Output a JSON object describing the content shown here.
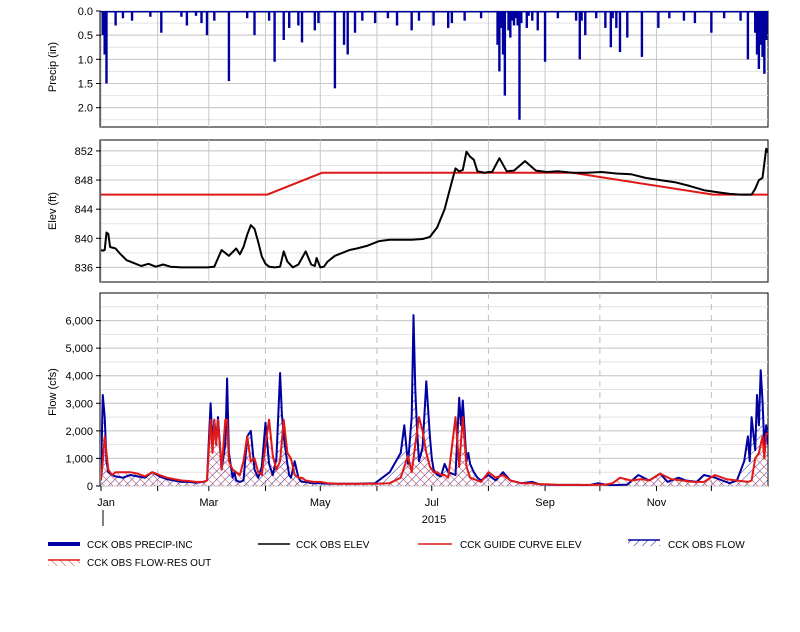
{
  "colors": {
    "precip": "#0000A0",
    "obs_elev": "#000000",
    "guide_curve": "#E01818",
    "obs_flow": "#0000A0",
    "res_out": "#E01818",
    "grid": "#C8C8C8",
    "month_marker": "#BEBEBE"
  },
  "chart_data": [
    {
      "type": "bar",
      "panel": "precipitation",
      "ylabel": "Precip (in)",
      "y_inverted": true,
      "ylim": [
        0,
        2.4
      ],
      "yticks": [
        0.0,
        0.5,
        1.0,
        1.5,
        2.0
      ],
      "ytick_labels": [
        "0.0",
        "0.5",
        "1.0",
        "1.5",
        "2.0"
      ],
      "grid": true,
      "series": [
        {
          "name": "CCK OBS PRECIP-INC",
          "x": [
            1,
            2,
            3,
            8,
            12,
            17,
            27,
            33,
            44,
            47,
            52,
            55,
            58,
            62,
            70,
            80,
            84,
            92,
            95,
            100,
            103,
            108,
            110,
            117,
            119,
            128,
            133,
            135,
            139,
            143,
            150,
            157,
            162,
            170,
            174,
            182,
            190,
            192,
            199,
            208,
            219,
            226,
            230,
            233,
            236,
            239,
            243,
            250,
            260,
            271,
            276,
            279,
            284,
            288,
            296,
            305,
            311,
            319,
            325,
            334,
            341,
            350,
            354,
            358,
            362,
            364
          ],
          "values": [
            0.5,
            0.9,
            1.5,
            0.3,
            0.15,
            0.2,
            0.12,
            0.45,
            0.12,
            0.3,
            0.1,
            0.25,
            0.5,
            0.2,
            1.45,
            0.15,
            0.5,
            0.2,
            1.05,
            0.6,
            0.35,
            0.3,
            0.65,
            0.4,
            0.25,
            1.6,
            0.7,
            0.9,
            0.45,
            0.2,
            0.25,
            0.15,
            0.3,
            0.4,
            0.2,
            0.3,
            0.35,
            0.25,
            0.2,
            0.15,
            0.35,
            0.3,
            0.25,
            0.35,
            0.2,
            0.4,
            1.05,
            0.15,
            0.2,
            0.15,
            0.35,
            0.75,
            0.85,
            0.55,
            0.95,
            0.35,
            0.15,
            0.2,
            0.25,
            0.45,
            0.15,
            0.2,
            1.0,
            0.1,
            0.2,
            0.5
          ],
          "x_extra_spikes": [
            [
              217,
              0.7
            ],
            [
              218,
              1.25
            ],
            [
              220,
              0.9
            ],
            [
              221,
              1.75
            ],
            [
              223,
              0.4
            ],
            [
              224,
              0.55
            ],
            [
              225,
              0.2
            ],
            [
              227,
              0.15
            ],
            [
              228,
              0.3
            ],
            [
              229,
              2.25
            ],
            [
              234,
              0.1
            ],
            [
              262,
              1.0
            ],
            [
              263,
              0.2
            ],
            [
              265,
              0.5
            ],
            [
              280,
              0.15
            ],
            [
              282,
              0.35
            ],
            [
              358,
              0.45
            ],
            [
              359,
              0.9
            ],
            [
              360,
              1.2
            ],
            [
              361,
              0.7
            ],
            [
              362,
              0.95
            ],
            [
              363,
              1.3
            ],
            [
              364,
              0.6
            ],
            [
              365,
              0.3
            ]
          ]
        }
      ]
    },
    {
      "type": "line",
      "panel": "elevation",
      "ylabel": "Elev (ft)",
      "ylim": [
        834,
        853.5
      ],
      "yticks": [
        836,
        840,
        844,
        848,
        852
      ],
      "ytick_labels": [
        "836",
        "840",
        "844",
        "848",
        "852"
      ],
      "grid": true,
      "series": [
        {
          "name": "CCK OBS ELEV",
          "x": [
            0,
            1,
            2,
            3,
            4,
            5,
            8,
            10,
            14,
            18,
            22,
            26,
            30,
            34,
            38,
            44,
            50,
            58,
            62,
            66,
            70,
            74,
            76,
            78,
            80,
            82,
            84,
            86,
            88,
            90,
            92,
            95,
            98,
            100,
            102,
            105,
            108,
            112,
            115,
            117,
            118,
            120,
            122,
            124,
            126,
            128,
            132,
            136,
            140,
            146,
            152,
            158,
            164,
            170,
            176,
            180,
            184,
            188,
            192,
            194,
            196,
            198,
            200,
            202,
            204,
            206,
            208,
            210,
            212,
            214,
            218,
            222,
            226,
            232,
            238,
            244,
            250,
            258,
            266,
            274,
            282,
            290,
            298,
            306,
            314,
            322,
            330,
            338,
            344,
            350,
            354,
            356,
            358,
            360,
            362,
            364,
            365
          ],
          "values": [
            838.4,
            838.3,
            838.4,
            840.8,
            840.6,
            838.8,
            838.6,
            838.0,
            837.0,
            836.6,
            836.2,
            836.5,
            836.1,
            836.4,
            836.1,
            836.0,
            836.0,
            836.0,
            836.1,
            838.4,
            837.6,
            838.6,
            837.8,
            838.8,
            840.5,
            841.8,
            841.3,
            839.5,
            837.5,
            836.5,
            836.1,
            836.0,
            836.1,
            838.2,
            836.8,
            836.0,
            836.4,
            838.2,
            836.4,
            836.2,
            837.3,
            836.0,
            836.1,
            836.8,
            837.2,
            837.6,
            838.0,
            838.4,
            838.6,
            839.0,
            839.6,
            839.8,
            839.8,
            839.8,
            839.9,
            840.2,
            841.5,
            844.0,
            847.8,
            849.6,
            849.2,
            849.4,
            851.9,
            851.2,
            850.8,
            849.2,
            849.1,
            849.0,
            849.1,
            849.1,
            851.0,
            849.2,
            849.3,
            850.6,
            849.3,
            849.1,
            849.2,
            849.0,
            849.0,
            849.1,
            848.9,
            848.8,
            848.3,
            848.0,
            847.7,
            847.2,
            846.6,
            846.3,
            846.1,
            846.0,
            846.0,
            846.0,
            846.8,
            848.0,
            848.3,
            852.3,
            851.8
          ]
        },
        {
          "name": "CCK GUIDE CURVE ELEV",
          "x": [
            0,
            91,
            121,
            258,
            335,
            365
          ],
          "values": [
            846.0,
            846.0,
            849.0,
            849.0,
            846.0,
            846.0
          ]
        }
      ]
    },
    {
      "type": "area",
      "panel": "flow",
      "ylabel": "Flow (cfs)",
      "ylim": [
        0,
        7000
      ],
      "yticks": [
        0,
        1000,
        2000,
        3000,
        4000,
        5000,
        6000
      ],
      "ytick_labels": [
        "0",
        "1,000",
        "2,000",
        "3,000",
        "4,000",
        "5,000",
        "6,000"
      ],
      "grid": true,
      "xlabel": "2015",
      "xtick_labels": [
        "Jan",
        "Mar",
        "May",
        "Jul",
        "Sep",
        "Nov"
      ],
      "xtick_days": [
        0,
        59,
        120,
        181,
        243,
        304
      ],
      "series": [
        {
          "name": "CCK OBS FLOW",
          "x": [
            0,
            1,
            2,
            3,
            4,
            6,
            8,
            12,
            16,
            20,
            24,
            28,
            32,
            36,
            40,
            44,
            48,
            52,
            56,
            58,
            60,
            61,
            62,
            63,
            64,
            66,
            68,
            69,
            70,
            72,
            73,
            74,
            76,
            78,
            80,
            82,
            84,
            86,
            88,
            90,
            92,
            94,
            96,
            98,
            99,
            100,
            102,
            103,
            104,
            106,
            108,
            109,
            110,
            112,
            114,
            116,
            120,
            124,
            130,
            140,
            150,
            158,
            164,
            166,
            168,
            170,
            171,
            172,
            173,
            174,
            176,
            178,
            180,
            181,
            182,
            184,
            186,
            188,
            190,
            194,
            196,
            197,
            198,
            200,
            201,
            202,
            204,
            206,
            208,
            212,
            216,
            220,
            224,
            230,
            236,
            240,
            244,
            250,
            256,
            262,
            266,
            268,
            272,
            276,
            280,
            284,
            288,
            294,
            300,
            306,
            310,
            316,
            320,
            326,
            330,
            336,
            340,
            344,
            348,
            352,
            354,
            355,
            356,
            358,
            359,
            360,
            361,
            362,
            363,
            364,
            365
          ],
          "values": [
            400,
            3300,
            2500,
            900,
            500,
            400,
            350,
            300,
            400,
            350,
            300,
            500,
            350,
            250,
            200,
            150,
            150,
            120,
            150,
            200,
            3000,
            1500,
            2400,
            1600,
            2500,
            600,
            1500,
            3900,
            1200,
            300,
            500,
            200,
            150,
            200,
            1800,
            2000,
            600,
            300,
            700,
            2300,
            800,
            400,
            1000,
            4100,
            2600,
            1800,
            800,
            400,
            300,
            900,
            300,
            200,
            150,
            150,
            120,
            100,
            100,
            80,
            80,
            80,
            100,
            500,
            1200,
            2200,
            800,
            2500,
            6200,
            3500,
            2000,
            900,
            1400,
            3800,
            1800,
            1000,
            600,
            400,
            350,
            800,
            500,
            400,
            3200,
            2200,
            3100,
            900,
            1200,
            800,
            500,
            300,
            200,
            400,
            200,
            500,
            200,
            100,
            150,
            60,
            50,
            40,
            40,
            40,
            30,
            40,
            100,
            50,
            30,
            40,
            50,
            400,
            200,
            450,
            150,
            300,
            200,
            150,
            400,
            300,
            200,
            100,
            200,
            900,
            1800,
            900,
            2500,
            1300,
            3300,
            2200,
            4200,
            3100,
            1500,
            2200,
            1500
          ]
        },
        {
          "name": "CCK OBS FLOW-RES OUT",
          "x": [
            0,
            1,
            2,
            3,
            4,
            6,
            8,
            12,
            16,
            20,
            24,
            28,
            32,
            36,
            40,
            44,
            48,
            52,
            56,
            58,
            60,
            61,
            62,
            63,
            64,
            66,
            68,
            69,
            70,
            72,
            74,
            76,
            78,
            80,
            82,
            84,
            86,
            88,
            90,
            92,
            94,
            96,
            98,
            100,
            102,
            104,
            106,
            108,
            110,
            112,
            116,
            120,
            124,
            130,
            140,
            150,
            158,
            164,
            166,
            168,
            170,
            172,
            174,
            176,
            178,
            180,
            182,
            184,
            186,
            188,
            190,
            194,
            196,
            198,
            200,
            202,
            204,
            206,
            208,
            212,
            216,
            220,
            224,
            230,
            236,
            240,
            244,
            250,
            256,
            262,
            266,
            270,
            276,
            280,
            284,
            290,
            296,
            300,
            306,
            312,
            318,
            324,
            330,
            336,
            342,
            348,
            354,
            356,
            358,
            360,
            362,
            363,
            364,
            365
          ],
          "values": [
            200,
            900,
            1800,
            1200,
            600,
            400,
            500,
            500,
            500,
            450,
            350,
            500,
            400,
            300,
            250,
            200,
            180,
            150,
            150,
            200,
            2400,
            1200,
            2400,
            1500,
            2400,
            600,
            2400,
            2400,
            900,
            600,
            500,
            400,
            900,
            1800,
            900,
            1000,
            500,
            400,
            1500,
            2400,
            1100,
            600,
            900,
            2400,
            1200,
            1000,
            400,
            300,
            300,
            200,
            150,
            150,
            100,
            80,
            80,
            80,
            100,
            300,
            700,
            1100,
            500,
            1500,
            2500,
            2000,
            1200,
            700,
            500,
            500,
            400,
            400,
            300,
            2500,
            700,
            2500,
            700,
            300,
            250,
            200,
            150,
            500,
            300,
            400,
            200,
            100,
            100,
            60,
            60,
            40,
            40,
            40,
            40,
            40,
            50,
            100,
            300,
            200,
            250,
            200,
            450,
            250,
            200,
            150,
            150,
            400,
            250,
            200,
            150,
            200,
            1000,
            1200,
            1800,
            1000,
            1900,
            1900
          ]
        }
      ]
    }
  ],
  "legend": {
    "placement": "bottom",
    "items": [
      {
        "label": "CCK OBS PRECIP-INC",
        "style": "thick-line",
        "color": "#0000A0"
      },
      {
        "label": "CCK OBS ELEV",
        "style": "line",
        "color": "#000000"
      },
      {
        "label": "CCK GUIDE CURVE ELEV",
        "style": "line",
        "color": "#E01818"
      },
      {
        "label": "CCK OBS FLOW",
        "style": "hatched",
        "color": "#0000A0"
      },
      {
        "label": "CCK OBS FLOW-RES OUT",
        "style": "hatched",
        "color": "#E01818"
      }
    ]
  }
}
